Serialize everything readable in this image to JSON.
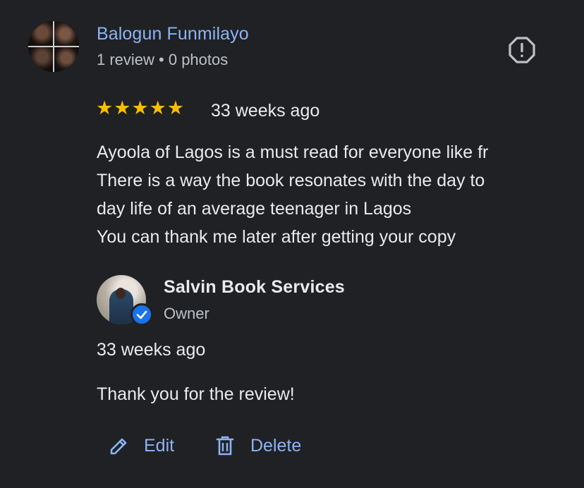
{
  "reviewer": {
    "name": "Balogun Funmilayo",
    "meta": "1 review • 0 photos"
  },
  "review": {
    "rating": 5,
    "stars": [
      "★",
      "★",
      "★",
      "★",
      "★"
    ],
    "time": "33 weeks ago",
    "lines": [
      "Ayoola of Lagos is a must read for everyone like fr",
      "There is a way the book resonates with the day to",
      "day life of an average teenager in Lagos",
      "You can thank me later after getting your copy"
    ]
  },
  "owner_reply": {
    "name": "Salvin Book Services",
    "role": "Owner",
    "time": "33 weeks ago",
    "text": "Thank you for the review!"
  },
  "actions": {
    "edit_label": "Edit",
    "delete_label": "Delete"
  },
  "icons": {
    "report": "report-flag-icon",
    "verified": "verified-check-icon",
    "edit": "pencil-icon",
    "delete": "trash-icon"
  },
  "colors": {
    "background": "#202124",
    "link": "#8ab4f8",
    "star": "#fbbc04",
    "text": "#e8eaed",
    "secondary_text": "#bdc1c6",
    "verified": "#1a73e8"
  }
}
